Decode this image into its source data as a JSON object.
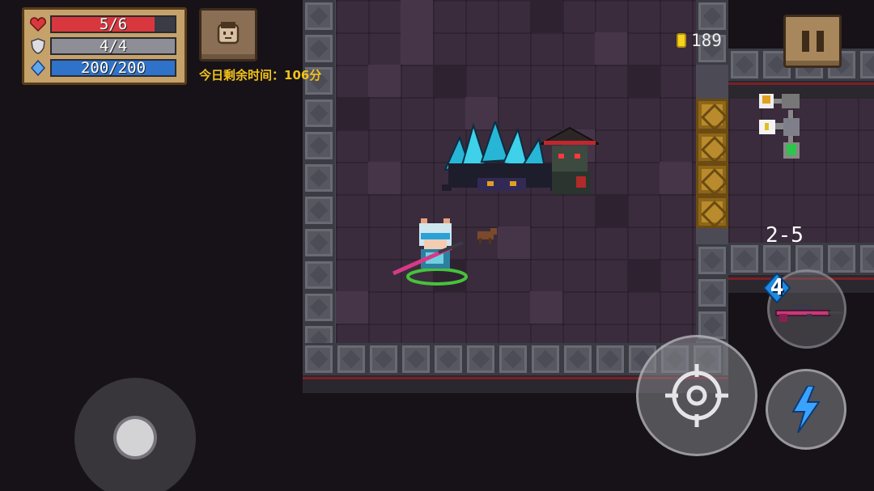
{
  "hud": {
    "health": {
      "text": "5/6",
      "current": 5,
      "max": 6,
      "color": "#d8383d"
    },
    "armor": {
      "text": "4/4",
      "current": 4,
      "max": 4,
      "color": "#8e8e96"
    },
    "energy": {
      "text": "200/200",
      "current": 200,
      "max": 200,
      "color": "#2f72c9"
    },
    "time_remaining": "今日剩余时间：106分",
    "coins": "189",
    "level": "2-5",
    "weapon_energy_cost": "4"
  },
  "icons": {
    "health": "heart-icon",
    "armor": "shield-icon",
    "energy": "diamond-icon",
    "avatar": "face-icon",
    "pause": "pause-icon",
    "coin": "coin-icon",
    "attack": "crosshair-icon",
    "skill": "lightning-icon",
    "weapon": "sniper-rifle-icon"
  },
  "colors": {
    "accent_gold": "#f2c21a",
    "skill_blue": "#3aa3ff",
    "energy_diamond": "#1e8ae0"
  }
}
